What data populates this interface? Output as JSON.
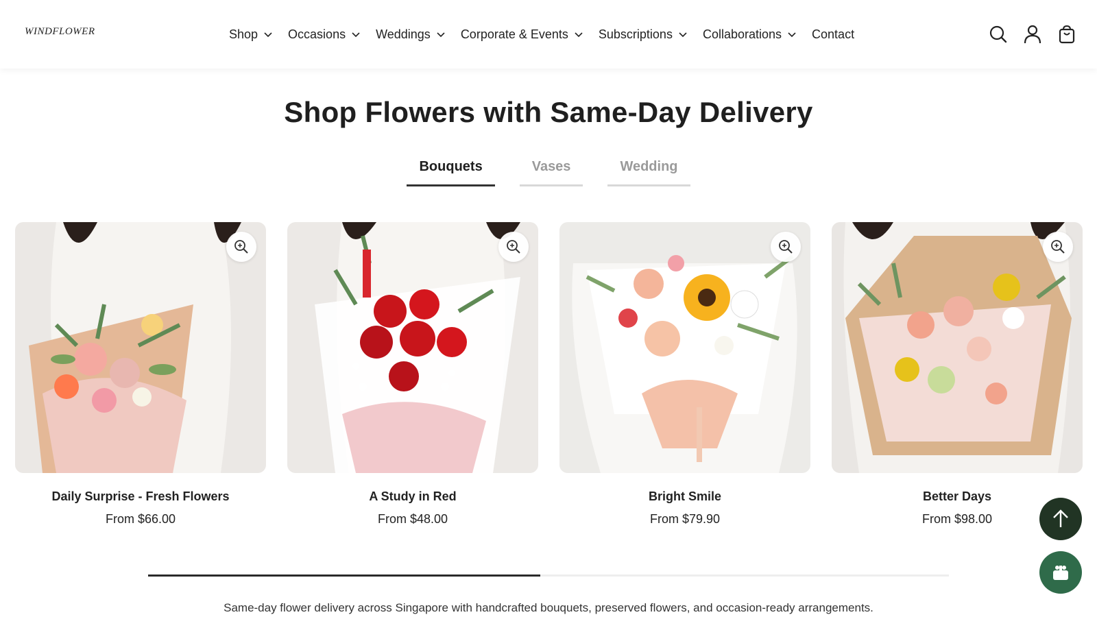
{
  "header": {
    "logo": "WINDFLOWER",
    "nav": [
      {
        "label": "Shop",
        "dropdown": true
      },
      {
        "label": "Occasions",
        "dropdown": true
      },
      {
        "label": "Weddings",
        "dropdown": true
      },
      {
        "label": "Corporate & Events",
        "dropdown": true
      },
      {
        "label": "Subscriptions",
        "dropdown": true
      },
      {
        "label": "Collaborations",
        "dropdown": true
      },
      {
        "label": "Contact",
        "dropdown": false
      }
    ],
    "icons": [
      "search-icon",
      "account-icon",
      "cart-icon"
    ]
  },
  "main": {
    "title": "Shop Flowers with Same-Day Delivery",
    "tabs": [
      {
        "label": "Bouquets",
        "active": true
      },
      {
        "label": "Vases",
        "active": false
      },
      {
        "label": "Wedding",
        "active": false
      }
    ],
    "products": [
      {
        "name": "Daily Surprise - Fresh Flowers",
        "price": "From $66.00",
        "palette": [
          "#f4a9a0",
          "#ff7a4d",
          "#f7d27a",
          "#e8b7b0"
        ]
      },
      {
        "name": "A Study in Red",
        "price": "From $48.00",
        "palette": [
          "#c8151b",
          "#ffffff",
          "#7aa05c",
          "#f2c9cc"
        ]
      },
      {
        "name": "Bright Smile",
        "price": "From $79.90",
        "palette": [
          "#f7b21e",
          "#f4b59a",
          "#ffffff",
          "#7fa36a"
        ]
      },
      {
        "name": "Better Days",
        "price": "From $98.00",
        "palette": [
          "#f2a38c",
          "#e6c21b",
          "#c8dc9a",
          "#d9b38c"
        ]
      }
    ],
    "scroll_progress": 0.49,
    "description": "Same-day flower delivery across Singapore with handcrafted bouquets, preserved flowers, and occasion-ready arrangements."
  },
  "colors": {
    "fab_top": "#213424",
    "fab_gift": "#2f6b4a",
    "text": "#1f1f1f"
  }
}
